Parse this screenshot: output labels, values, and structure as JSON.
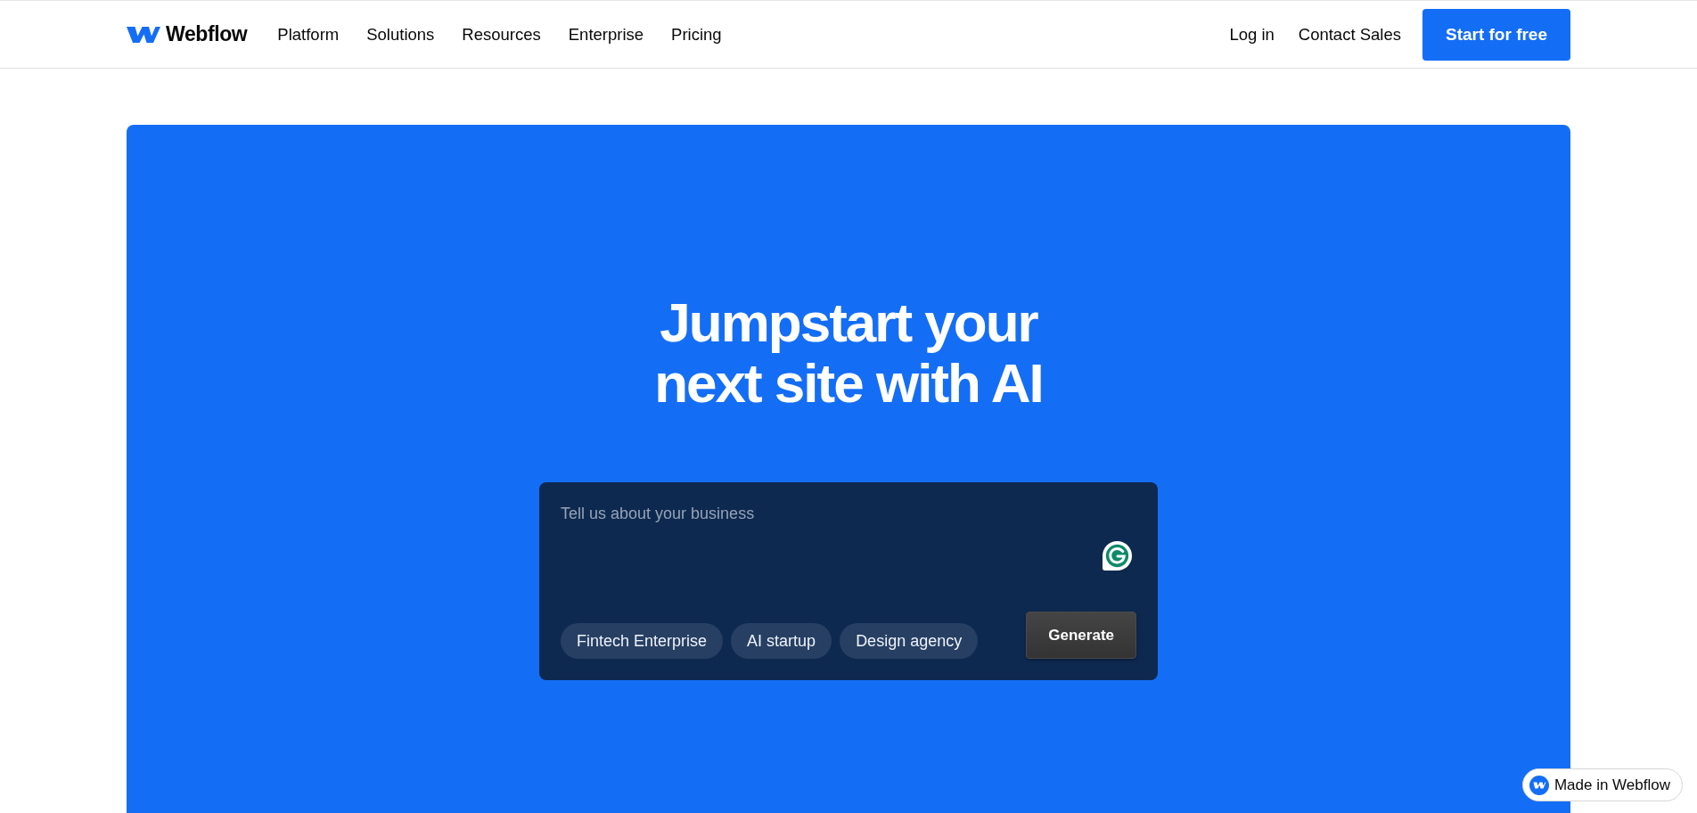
{
  "nav": {
    "logo_text": "Webflow",
    "menu": [
      {
        "label": "Platform"
      },
      {
        "label": "Solutions"
      },
      {
        "label": "Resources"
      },
      {
        "label": "Enterprise"
      },
      {
        "label": "Pricing"
      }
    ],
    "actions": [
      {
        "kind": "link",
        "label": "Log in"
      },
      {
        "kind": "link",
        "label": "Contact Sales"
      },
      {
        "kind": "button",
        "label": "Start for free"
      }
    ]
  },
  "hero": {
    "title_lines": [
      "Jumpstart your",
      "next site with AI"
    ],
    "prompt": {
      "placeholder": "Tell us about your business",
      "suggestions": [
        {
          "label": "Fintech Enterprise"
        },
        {
          "label": "AI startup"
        },
        {
          "label": "Design agency"
        }
      ],
      "submit_label": "Generate"
    }
  },
  "badge": {
    "label": "Made in Webflow"
  }
}
